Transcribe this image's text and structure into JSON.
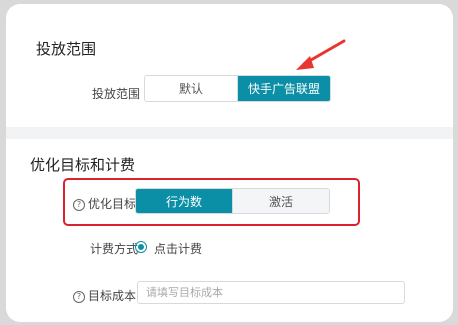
{
  "section1": {
    "title": "投放范围",
    "field_label": "投放范围",
    "options": [
      "默认",
      "快手广告联盟"
    ],
    "selected": "快手广告联盟"
  },
  "section2": {
    "title": "优化目标和计费",
    "goal_label": "优化目标",
    "goal_options": [
      "行为数",
      "激活"
    ],
    "goal_selected": "行为数",
    "billing_label": "计费方式",
    "billing_option": "点击计费",
    "cost_label": "目标成本",
    "cost_placeholder": "请填写目标成本"
  },
  "colors": {
    "accent": "#0b8fa6",
    "highlight": "#d9232e"
  }
}
